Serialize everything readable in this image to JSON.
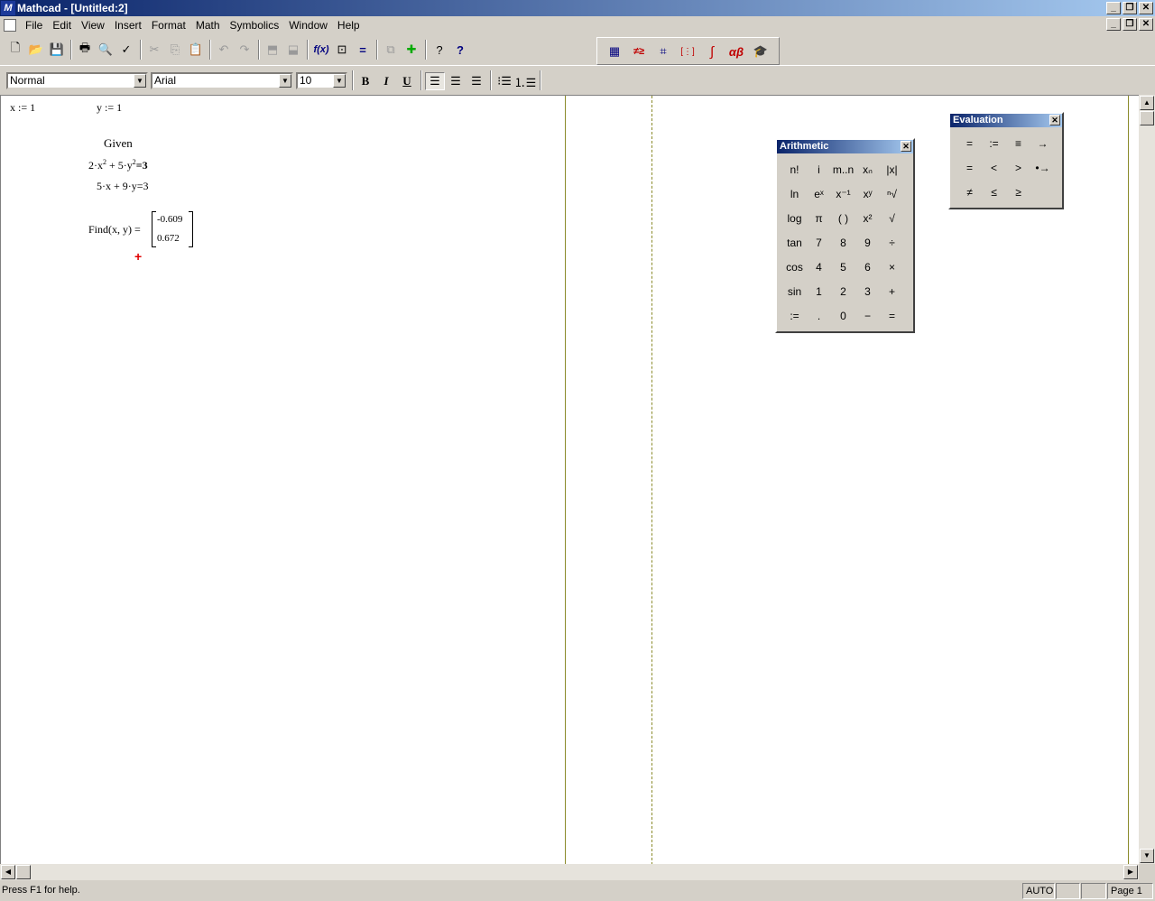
{
  "window": {
    "title": "Mathcad - [Untitled:2]",
    "min": "_",
    "restore": "❐",
    "close": "✕"
  },
  "menu": [
    "File",
    "Edit",
    "View",
    "Insert",
    "Format",
    "Math",
    "Symbolics",
    "Window",
    "Help"
  ],
  "toolbar": {
    "new": "🗋",
    "open": "📂",
    "save": "💾",
    "print": "🖶",
    "preview": "🔍",
    "spell": "✓",
    "cut": "✂",
    "copy": "⎘",
    "paste": "📋",
    "undo": "↶",
    "redo": "↷",
    "align_top": "⬒",
    "align_down": "⬓",
    "fx": "f(x)",
    "units": "⊡",
    "calc": "=",
    "component": "⧉",
    "resource": "✚",
    "help": "?",
    "info": "?"
  },
  "math_toolbar": {
    "calculator": "▦",
    "evaluation": "≠≥",
    "graph": "⌗",
    "matrix": "[⋮]",
    "calculus": "∫",
    "greek": "αβ",
    "symbolic": "🎓"
  },
  "format": {
    "style": "Normal",
    "font": "Arial",
    "size": "10",
    "bold": "B",
    "italic": "I",
    "underline": "U"
  },
  "worksheet": {
    "x_def": "x := 1",
    "y_def": "y := 1",
    "given": "Given",
    "eq1_a": "2·x",
    "eq1_exp1": "2",
    "eq1_b": " + 5·y",
    "eq1_exp2": "2",
    "eq1_c": "=3",
    "eq2": "5·x + 9·y=3",
    "find": "Find(x, y)  =",
    "result": [
      "-0.609",
      "0.672"
    ],
    "cursor": "+"
  },
  "palettes": {
    "arithmetic": {
      "title": "Arithmetic",
      "buttons": [
        "n!",
        "i",
        "m..n",
        "xₙ",
        "|x|",
        "ln",
        "eˣ",
        "x⁻¹",
        "xʸ",
        "ⁿ√",
        "log",
        "π",
        "( )",
        "x²",
        "√",
        "tan",
        "7",
        "8",
        "9",
        "÷",
        "cos",
        "4",
        "5",
        "6",
        "×",
        "sin",
        "1",
        "2",
        "3",
        "+",
        ":=",
        ".",
        "0",
        "−",
        "="
      ]
    },
    "evaluation": {
      "title": "Evaluation",
      "buttons": [
        "=",
        ":=",
        "≡",
        "→",
        "=",
        "<",
        ">",
        "•→",
        "≠",
        "≤",
        "≥"
      ]
    }
  },
  "status": {
    "help": "Press F1 for help.",
    "mode": "AUTO",
    "page": "Page 1"
  }
}
